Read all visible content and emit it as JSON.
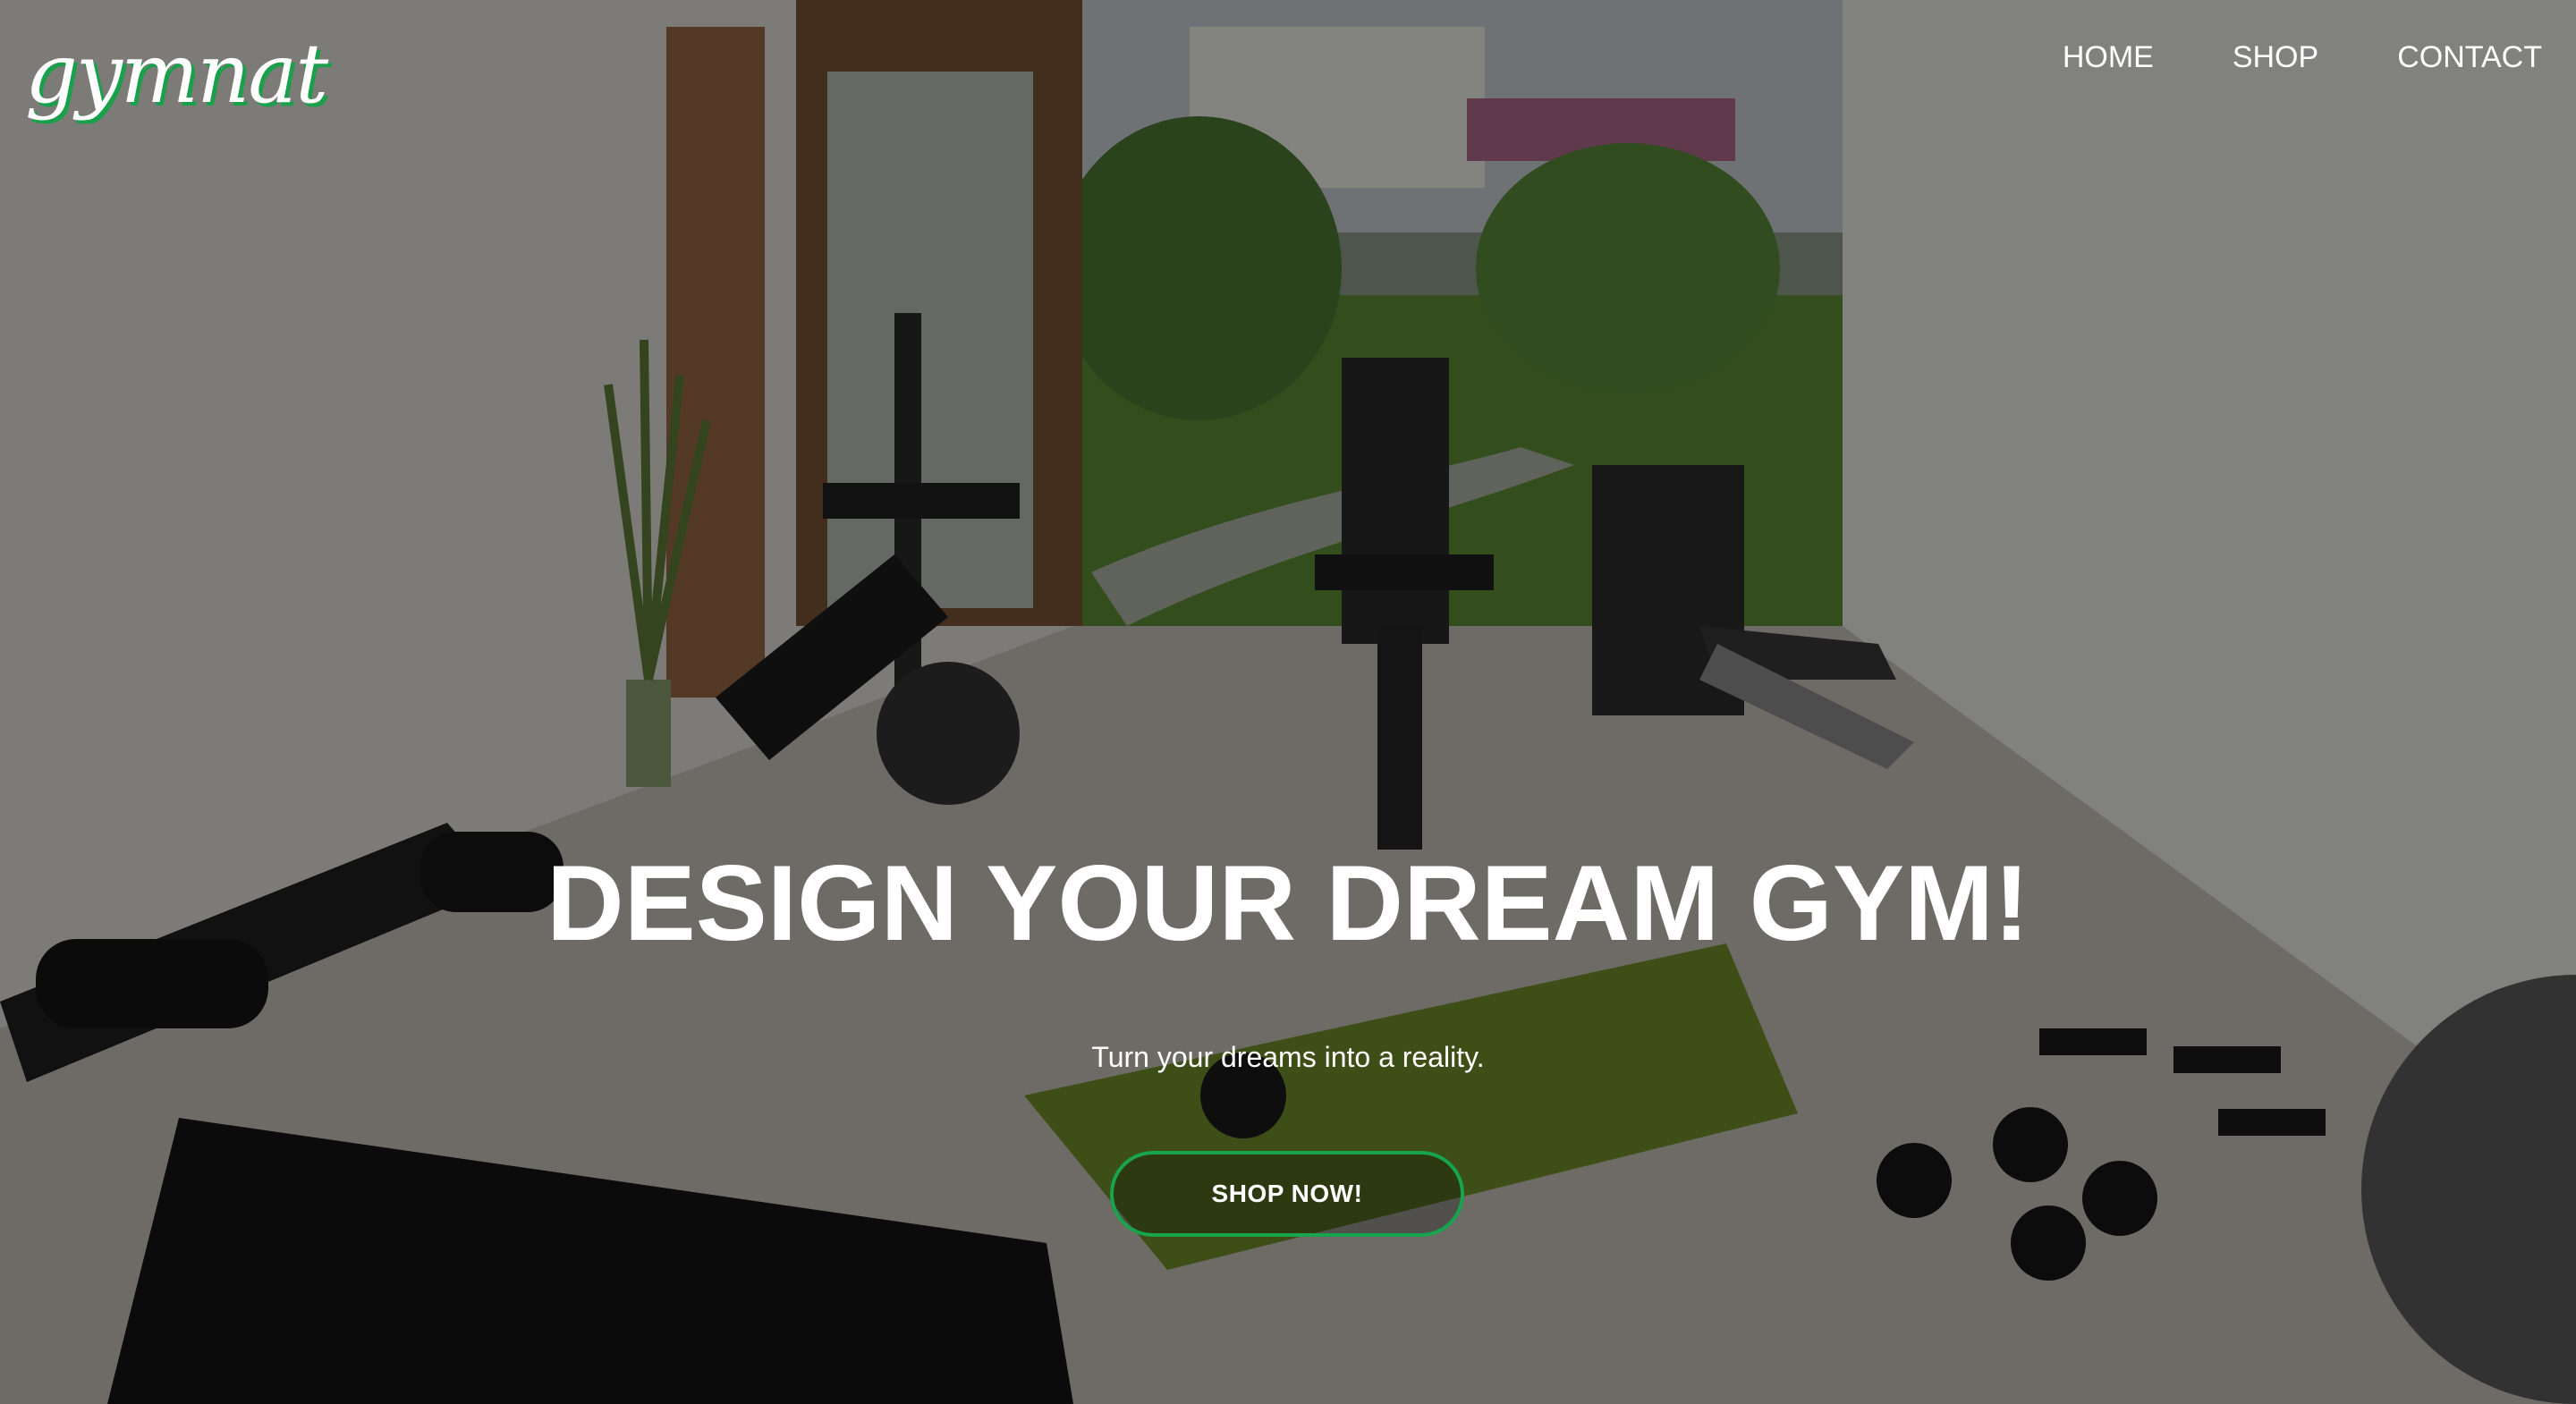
{
  "brand": {
    "logo_text": "gymnat",
    "accent_color": "#17a44c"
  },
  "nav": {
    "items": [
      {
        "label": "HOME"
      },
      {
        "label": "SHOP"
      },
      {
        "label": "CONTACT"
      }
    ]
  },
  "hero": {
    "headline": "DESIGN YOUR DREAM GYM!",
    "subheadline": "Turn your dreams into a reality.",
    "cta_label": "SHOP NOW!",
    "background": "home-gym-photo"
  }
}
